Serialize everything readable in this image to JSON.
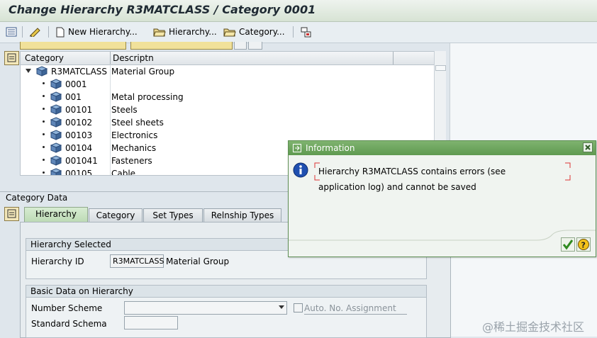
{
  "title": "Change Hierarchy R3MATCLASS / Category 0001",
  "toolbar": {
    "new_hierarchy": "New Hierarchy...",
    "hierarchy": "Hierarchy...",
    "category": "Category..."
  },
  "tree": {
    "columns": [
      "Category",
      "Descriptn"
    ],
    "root": {
      "cat": "R3MATCLASS",
      "desc": "Material Group"
    },
    "rows": [
      {
        "cat": "0001",
        "desc": ""
      },
      {
        "cat": "001",
        "desc": "Metal processing"
      },
      {
        "cat": "00101",
        "desc": "Steels"
      },
      {
        "cat": "00102",
        "desc": "Steel sheets"
      },
      {
        "cat": "00103",
        "desc": "Electronics"
      },
      {
        "cat": "00104",
        "desc": "Mechanics"
      },
      {
        "cat": "001041",
        "desc": "Fasteners"
      },
      {
        "cat": "00105",
        "desc": "Cable"
      }
    ]
  },
  "category_data": {
    "label": "Category Data",
    "tabs": [
      "Hierarchy",
      "Category",
      "Set Types",
      "Relnship Types"
    ],
    "hierarchy_selected": {
      "title": "Hierarchy Selected",
      "id_label": "Hierarchy ID",
      "id_value": "R3MATCLASS",
      "id_desc": "Material Group"
    },
    "basic_data": {
      "title": "Basic Data on Hierarchy",
      "number_scheme_label": "Number Scheme",
      "number_scheme_value": "",
      "auto_no_label": "Auto. No. Assignment",
      "standard_schema_label": "Standard Schema",
      "standard_schema_value": ""
    }
  },
  "dialog": {
    "title": "Information",
    "message_line1": "Hierarchy R3MATCLASS contains errors (see",
    "message_line2": "application log) and cannot be saved"
  },
  "watermark": "@稀土掘金技术社区"
}
